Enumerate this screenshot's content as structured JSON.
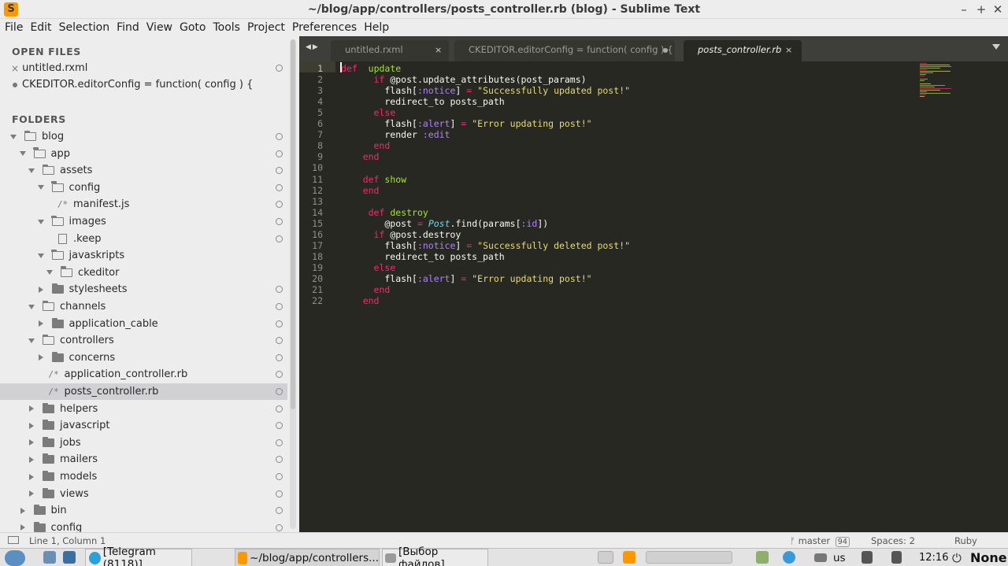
{
  "window": {
    "title": "~/blog/app/controllers/posts_controller.rb (blog) - Sublime Text",
    "app_icon": "S",
    "controls": [
      "–",
      "+",
      "✕"
    ]
  },
  "menu": [
    "File",
    "Edit",
    "Selection",
    "Find",
    "View",
    "Goto",
    "Tools",
    "Project",
    "Preferences",
    "Help"
  ],
  "sidebar": {
    "open_files_header": "OPEN FILES",
    "folders_header": "FOLDERS",
    "open_files": [
      {
        "name": "untitled.rxml",
        "marker": "×"
      },
      {
        "name": "CKEDITOR.editorConfig = function( config ) {",
        "marker": "dot"
      }
    ],
    "tree": [
      {
        "label": "blog",
        "depth": 0,
        "kind": "folder",
        "state": "open"
      },
      {
        "label": "app",
        "depth": 1,
        "kind": "folder",
        "state": "open"
      },
      {
        "label": "assets",
        "depth": 2,
        "kind": "folder",
        "state": "open"
      },
      {
        "label": "config",
        "depth": 3,
        "kind": "folder",
        "state": "open"
      },
      {
        "label": "manifest.js",
        "depth": 4,
        "kind": "file",
        "glyph": "/*"
      },
      {
        "label": "images",
        "depth": 3,
        "kind": "folder",
        "state": "open"
      },
      {
        "label": ".keep",
        "depth": 4,
        "kind": "file",
        "glyph": "blank"
      },
      {
        "label": "javaskripts",
        "depth": 3,
        "kind": "folder",
        "state": "open"
      },
      {
        "label": "ckeditor",
        "depth": 4,
        "kind": "folder",
        "state": "open"
      },
      {
        "label": "stylesheets",
        "depth": 3,
        "kind": "folder",
        "state": "closed"
      },
      {
        "label": "channels",
        "depth": 2,
        "kind": "folder",
        "state": "open"
      },
      {
        "label": "application_cable",
        "depth": 3,
        "kind": "folder",
        "state": "closed"
      },
      {
        "label": "controllers",
        "depth": 2,
        "kind": "folder",
        "state": "open"
      },
      {
        "label": "concerns",
        "depth": 3,
        "kind": "folder",
        "state": "closed"
      },
      {
        "label": "application_controller.rb",
        "depth": 3,
        "kind": "file",
        "glyph": "/*"
      },
      {
        "label": "posts_controller.rb",
        "depth": 3,
        "kind": "file",
        "glyph": "/*",
        "selected": true
      },
      {
        "label": "helpers",
        "depth": 2,
        "kind": "folder",
        "state": "closed"
      },
      {
        "label": "javascript",
        "depth": 2,
        "kind": "folder",
        "state": "closed"
      },
      {
        "label": "jobs",
        "depth": 2,
        "kind": "folder",
        "state": "closed"
      },
      {
        "label": "mailers",
        "depth": 2,
        "kind": "folder",
        "state": "closed"
      },
      {
        "label": "models",
        "depth": 2,
        "kind": "folder",
        "state": "closed"
      },
      {
        "label": "views",
        "depth": 2,
        "kind": "folder",
        "state": "closed"
      },
      {
        "label": "bin",
        "depth": 1,
        "kind": "folder",
        "state": "closed"
      },
      {
        "label": "config",
        "depth": 1,
        "kind": "folder",
        "state": "closed"
      }
    ]
  },
  "tabs": [
    {
      "label": "untitled.rxml",
      "state": "inactive",
      "close": "×"
    },
    {
      "label": "CKEDITOR.editorConfig = function( config ) {",
      "state": "inactive-modified"
    },
    {
      "label": "posts_controller.rb",
      "state": "active",
      "close": "×"
    }
  ],
  "code_lines": [
    [
      [
        "kw",
        "def"
      ],
      [
        "",
        "  "
      ],
      [
        "fn",
        "update"
      ]
    ],
    [
      [
        "",
        "      "
      ],
      [
        "kw",
        "if"
      ],
      [
        "",
        " @post.update_attributes(post_params)"
      ]
    ],
    [
      [
        "",
        "        flash["
      ],
      [
        "sym",
        ":notice"
      ],
      [
        "",
        "] "
      ],
      [
        "kw",
        "="
      ],
      [
        "",
        " "
      ],
      [
        "str",
        "\"Successfully updated post!\""
      ]
    ],
    [
      [
        "",
        "        redirect_to posts_path"
      ]
    ],
    [
      [
        "",
        "      "
      ],
      [
        "kw",
        "else"
      ]
    ],
    [
      [
        "",
        "        flash["
      ],
      [
        "sym",
        ":alert"
      ],
      [
        "",
        "] "
      ],
      [
        "kw",
        "="
      ],
      [
        "",
        " "
      ],
      [
        "str",
        "\"Error updating post!\""
      ]
    ],
    [
      [
        "",
        "        render "
      ],
      [
        "sym",
        ":edit"
      ]
    ],
    [
      [
        "",
        "      "
      ],
      [
        "kw",
        "end"
      ]
    ],
    [
      [
        "",
        "    "
      ],
      [
        "kw",
        "end"
      ]
    ],
    [],
    [
      [
        "",
        "    "
      ],
      [
        "kw",
        "def"
      ],
      [
        "",
        " "
      ],
      [
        "fn",
        "show"
      ]
    ],
    [
      [
        "",
        "    "
      ],
      [
        "kw",
        "end"
      ]
    ],
    [],
    [
      [
        "",
        "     "
      ],
      [
        "kw",
        "def"
      ],
      [
        "",
        " "
      ],
      [
        "fn",
        "destroy"
      ]
    ],
    [
      [
        "",
        "        @post "
      ],
      [
        "kw",
        "="
      ],
      [
        "",
        " "
      ],
      [
        "cls",
        "Post"
      ],
      [
        "",
        ".find(params["
      ],
      [
        "sym",
        ":id"
      ],
      [
        "",
        "])"
      ]
    ],
    [
      [
        "",
        "      "
      ],
      [
        "kw",
        "if"
      ],
      [
        "",
        " @post.destroy"
      ]
    ],
    [
      [
        "",
        "        flash["
      ],
      [
        "sym",
        ":notice"
      ],
      [
        "",
        "] "
      ],
      [
        "kw",
        "="
      ],
      [
        "",
        " "
      ],
      [
        "str",
        "\"Successfully deleted post!\""
      ]
    ],
    [
      [
        "",
        "        redirect_to posts_path"
      ]
    ],
    [
      [
        "",
        "      "
      ],
      [
        "kw",
        "else"
      ]
    ],
    [
      [
        "",
        "        flash["
      ],
      [
        "sym",
        ":alert"
      ],
      [
        "",
        "] "
      ],
      [
        "kw",
        "="
      ],
      [
        "",
        " "
      ],
      [
        "str",
        "\"Error updating post!\""
      ]
    ],
    [
      [
        "",
        "      "
      ],
      [
        "kw",
        "end"
      ]
    ],
    [
      [
        "",
        "    "
      ],
      [
        "kw",
        "end"
      ]
    ]
  ],
  "status": {
    "position": "Line 1, Column 1",
    "branch": "master",
    "branch_count": "94",
    "spaces": "Spaces: 2",
    "syntax": "Ruby"
  },
  "taskbar": {
    "telegram": "[Telegram (8118)]",
    "sublime": "~/blog/app/controllers...",
    "files": "[Выбор файлов]",
    "layout": "us",
    "time": "12:16",
    "none": "None"
  },
  "colors": {
    "editor_bg": "#272822",
    "keyword": "#f92672",
    "function": "#a6e22e",
    "symbol": "#ae81ff",
    "string": "#e6db74",
    "class": "#66d9ef"
  }
}
